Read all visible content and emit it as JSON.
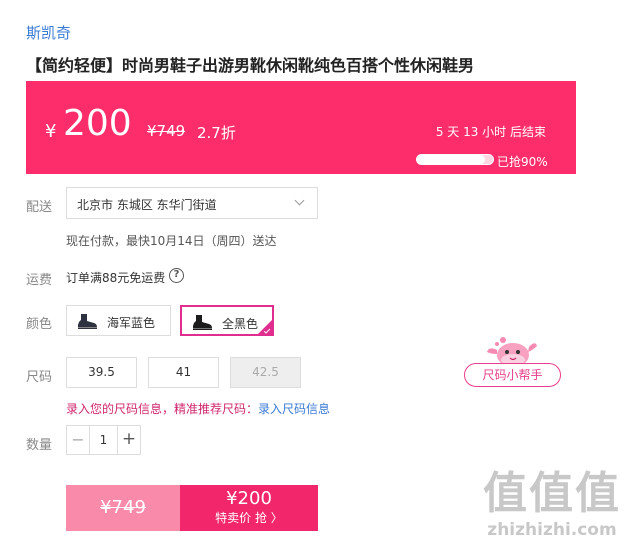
{
  "brand": "斯凯奇",
  "product_title": "【简约轻便】时尚男鞋子出游男靴休闲靴纯色百搭个性休闲鞋男",
  "price_banner": {
    "currency": "¥",
    "price": "200",
    "original_price": "¥749",
    "discount": "2.7折",
    "timer": "5 天 13 小时 后结束",
    "sold_percent": 0.9,
    "sold_text": "已抢90%",
    "color": "#fd2d6b"
  },
  "delivery": {
    "label": "配送",
    "address": "北京市 东城区 东华门街道",
    "note": "现在付款，最快10月14日（周四）送达"
  },
  "freight": {
    "label": "运费",
    "text": "订单满88元免运费",
    "help_icon": "?"
  },
  "colors": {
    "label": "颜色",
    "options": [
      {
        "name": "海军蓝色",
        "selected": false
      },
      {
        "name": "全黑色",
        "selected": true
      }
    ],
    "accent": "#e02e8f"
  },
  "sizes": {
    "label": "尺码",
    "options": [
      {
        "value": "39.5",
        "available": true
      },
      {
        "value": "41",
        "available": true
      },
      {
        "value": "42.5",
        "available": false
      }
    ],
    "helper": "尺码小帮手",
    "tip_prefix": "录入您的尺码信息，精准推荐尺码：",
    "tip_link": "录入尺码信息"
  },
  "quantity": {
    "label": "数量",
    "minus": "−",
    "value": "1",
    "plus": "+"
  },
  "buy": {
    "original": "¥749",
    "price": "¥200",
    "action": "特卖价 抢 〉"
  },
  "watermark": {
    "big": "值值值",
    "url": "zhizhizhi.com"
  }
}
